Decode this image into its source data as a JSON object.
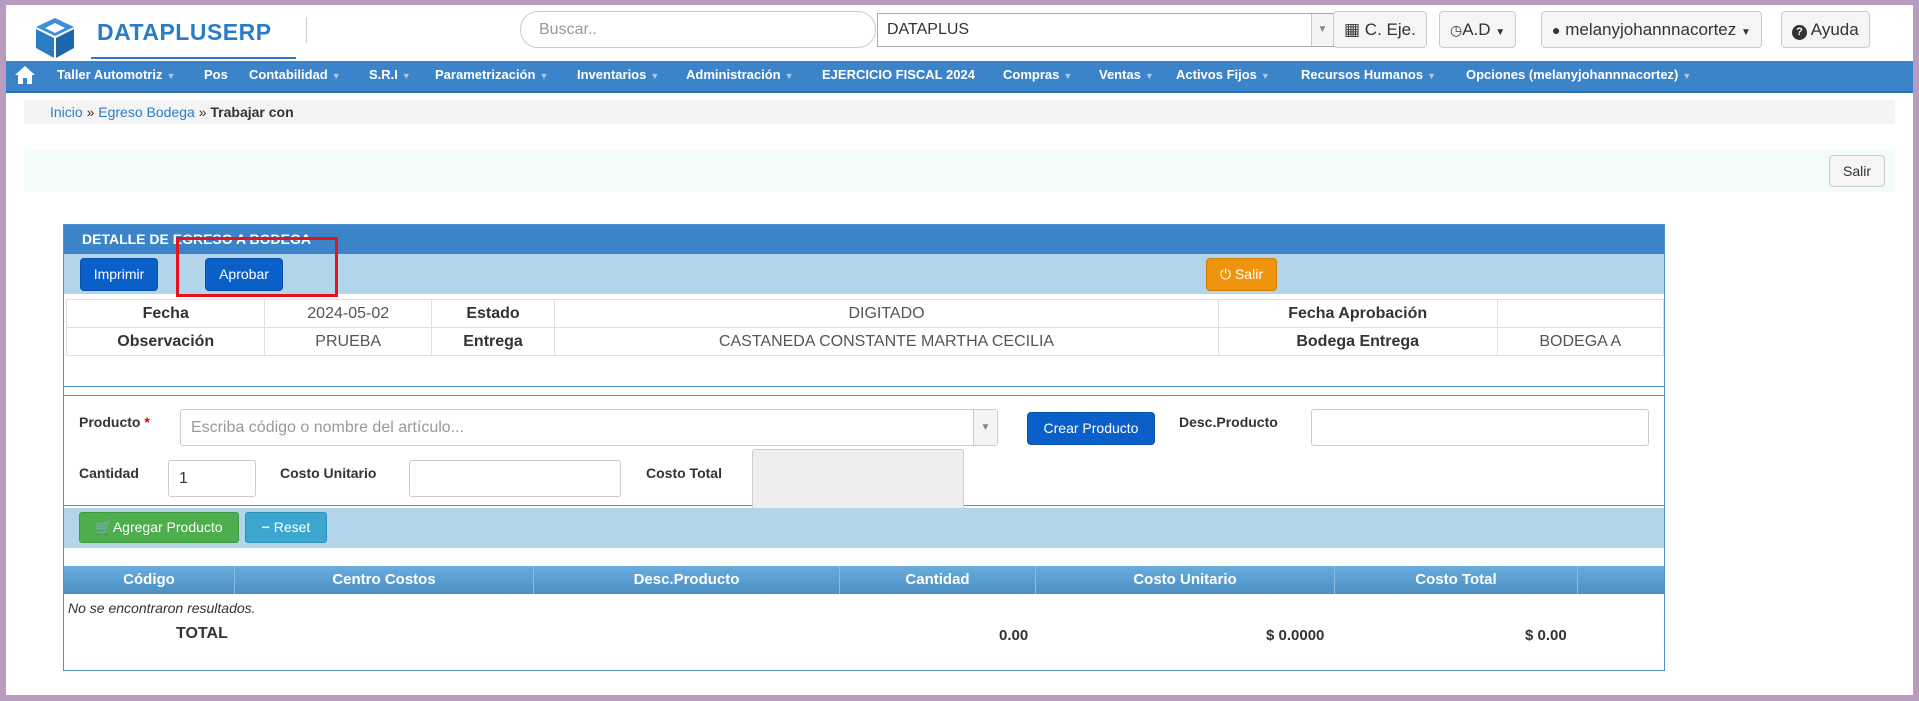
{
  "header": {
    "brand": "DATAPLUSERP",
    "search_placeholder": "Buscar..",
    "company": "DATAPLUS",
    "btn_cje": "C. Eje.",
    "btn_ad": "A.D",
    "btn_user": "melanyjohannnacortez",
    "btn_help": "Ayuda"
  },
  "nav": {
    "items": [
      {
        "label": "Taller Automotriz"
      },
      {
        "label": "Pos"
      },
      {
        "label": "Contabilidad"
      },
      {
        "label": "S.R.I"
      },
      {
        "label": "Parametrización"
      },
      {
        "label": "Inventarios"
      },
      {
        "label": "Administración"
      },
      {
        "label": "EJERCICIO FISCAL 2024"
      },
      {
        "label": "Compras"
      },
      {
        "label": "Ventas"
      },
      {
        "label": "Activos Fijos"
      },
      {
        "label": "Recursos Humanos"
      },
      {
        "label": "Opciones (melanyjohannnacortez)"
      }
    ]
  },
  "breadcrumb": {
    "home": "Inicio",
    "sep1": "»",
    "section": "Egreso Bodega",
    "sep2": "»",
    "current": "Trabajar con"
  },
  "toolbar": {
    "salir": "Salir"
  },
  "panel": {
    "title": "DETALLE DE EGRESO A BODEGA",
    "btn_imprimir": "Imprimir",
    "btn_aprobar": "Aprobar",
    "btn_salir": "Salir"
  },
  "info": {
    "fecha_label": "Fecha",
    "fecha": "2024-05-02",
    "estado_label": "Estado",
    "estado": "DIGITADO",
    "fecha_aprob_label": "Fecha Aprobación",
    "fecha_aprob": "",
    "obs_label": "Observación",
    "obs": "PRUEBA",
    "entrega_label": "Entrega",
    "entrega": "CASTANEDA CONSTANTE MARTHA CECILIA",
    "bodega_label": "Bodega Entrega",
    "bodega": "BODEGA A"
  },
  "form": {
    "producto_label": "Producto",
    "producto_placeholder": "Escriba código o nombre del artículo...",
    "crear_producto": "Crear Producto",
    "desc_label": "Desc.Producto",
    "cantidad_label": "Cantidad",
    "cantidad": "1",
    "costo_unit_label": "Costo Unitario",
    "costo_total_label": "Costo Total",
    "agregar": "Agregar Producto",
    "reset": "Reset"
  },
  "grid": {
    "columns": [
      "Código",
      "Centro Costos",
      "Desc.Producto",
      "Cantidad",
      "Costo Unitario",
      "Costo Total"
    ],
    "empty": "No se encontraron resultados.",
    "total_label": "TOTAL",
    "total_cantidad": "0.00",
    "total_costo_unit": "$ 0.0000",
    "total_costo": "$ 0.00"
  }
}
